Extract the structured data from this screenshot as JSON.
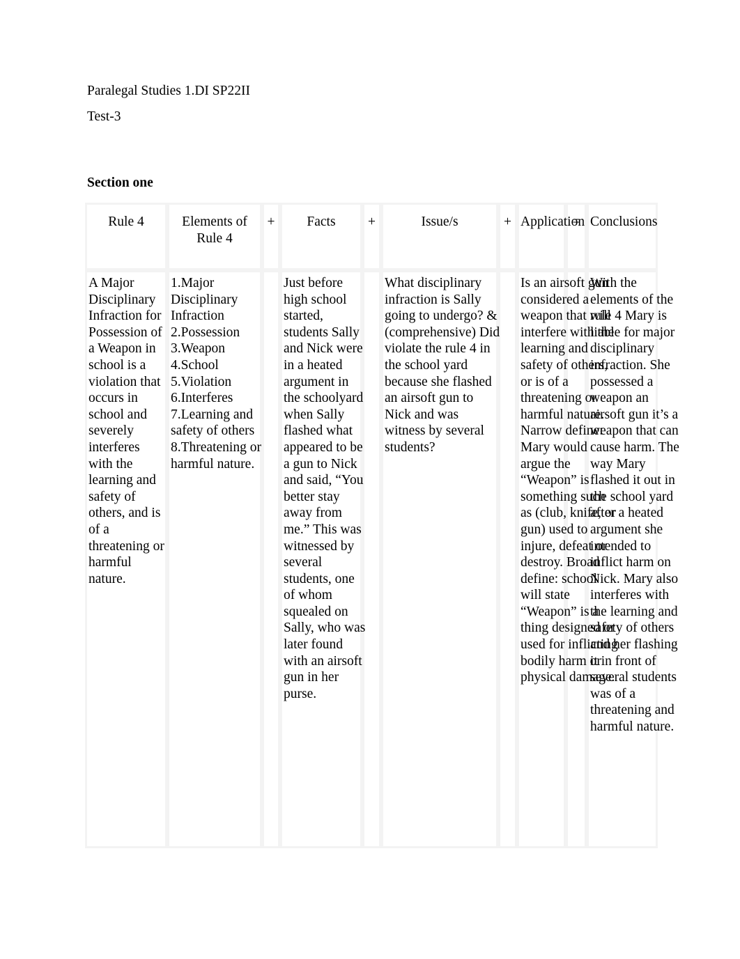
{
  "document": {
    "heading_line_1": "Paralegal Studies 1.DI SP22II",
    "heading_line_2": "Test-3",
    "section_title": "Section one"
  },
  "table": {
    "headers": {
      "rule": "Rule 4",
      "elements": "Elements of Rule 4",
      "plus_1": "+",
      "facts": "Facts",
      "plus_2": "+",
      "issue": "Issue/s",
      "plus_3": "+",
      "application": "Application",
      "equals": "=",
      "conclusions": "Conclusions"
    },
    "row": {
      "rule": "A Major Disciplinary Infraction for Possession of a Weapon in school is a violation that occurs in school and severely interferes with the learning and safety of others, and is of a threatening or harmful nature.",
      "elements": "1.Major Disciplinary Infraction 2.Possession 3.Weapon 4.School 5.Violation 6.Interferes 7.Learning and safety of others 8.Threatening or harmful nature.",
      "plus_1": "+",
      "facts": "Just before high school started, students Sally and Nick were in a heated argument in the schoolyard when Sally flashed what appeared to be a gun to Nick and said, “You better stay away from me.” This was witnessed by several students, one of whom squealed on Sally, who was later found with an airsoft gun in her purse.",
      "plus_2": "+",
      "issue": "What disciplinary infraction is Sally going to undergo? &(comprehensive) Did violate the rule 4 in the school yard because she flashed an airsoft gun to Nick and was witness by several students?",
      "plus_3": "+",
      "application": "Is an airsoft gun considered a weapon that will interfere with the learning and safety of others, or is of a threatening or harmful nature. Narrow define: Mary would argue the “Weapon” is something such as (club, knife, or gun) used to injure, defeat or destroy. Broad define: school will state “Weapon” is a thing designed or used for inflicting bodily harm or physical damage.",
      "equals": "=",
      "conclusions": "With the elements of the rule 4 Mary is liable for major disciplinary infraction. She possessed a weapon an airsoft gun it’s a weapon that can cause harm. The way Mary flashed it out in the school yard after a heated argument she intended to inflict harm on Nick. Mary also interferes with the learning and safety of others and her flashing it in front of several students was of a threatening and harmful nature."
    }
  },
  "colors": {
    "page_background": "#ffffff",
    "text": "#000000",
    "table_border": "#f3f3f3"
  }
}
